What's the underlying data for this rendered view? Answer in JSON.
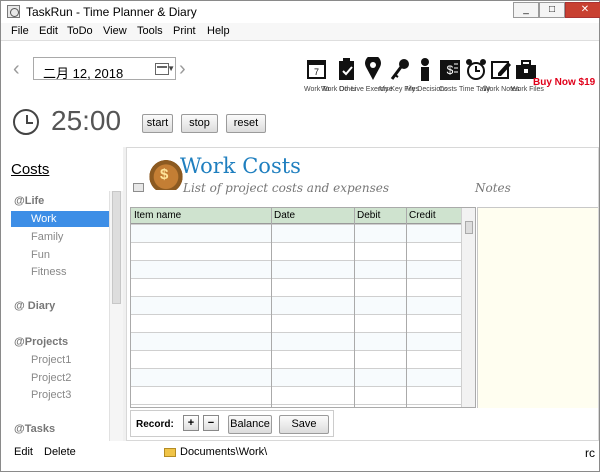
{
  "window": {
    "title": "TaskRun - Time Planner & Diary",
    "controls": [
      "_",
      "□",
      "✕"
    ]
  },
  "menu": [
    "File",
    "Edit",
    "ToDo",
    "View",
    "Tools",
    "Print",
    "Help"
  ],
  "date": "二月 12, 2018",
  "toolbar": {
    "buy_now": "Buy Now $19",
    "labels": [
      "Work To",
      "Work Do",
      "Other",
      "Live Exercise",
      "My Key Files",
      "My Decisions",
      "Costs",
      "Time Tally",
      "Work Notes",
      "Work Files"
    ]
  },
  "timer": {
    "display": "25:00",
    "buttons": [
      "start",
      "stop",
      "reset"
    ]
  },
  "left_panel": {
    "title": "Costs",
    "sections": [
      {
        "name": "@Life",
        "items": [
          "Work",
          "Family",
          "Fun",
          "Fitness"
        ],
        "selected": "Work"
      },
      {
        "name": "@ Diary",
        "items": []
      },
      {
        "name": "@Projects",
        "items": [
          "Project1",
          "Project2",
          "Project3"
        ]
      },
      {
        "name": "@Tasks",
        "items": []
      }
    ]
  },
  "main": {
    "title": "Work Costs",
    "subtitle": "List of project costs and expenses",
    "notes_title": "Notes",
    "columns": [
      "Item name",
      "Date",
      "Debit",
      "Credit"
    ],
    "rows": 11,
    "record_label": "Record:",
    "record_add": "+",
    "record_remove": "−",
    "balance_label": "Balance",
    "save_label": "Save"
  },
  "bottom": {
    "edit": "Edit",
    "delete": "Delete",
    "path": "Documents\\Work\\",
    "corner": "rc"
  }
}
